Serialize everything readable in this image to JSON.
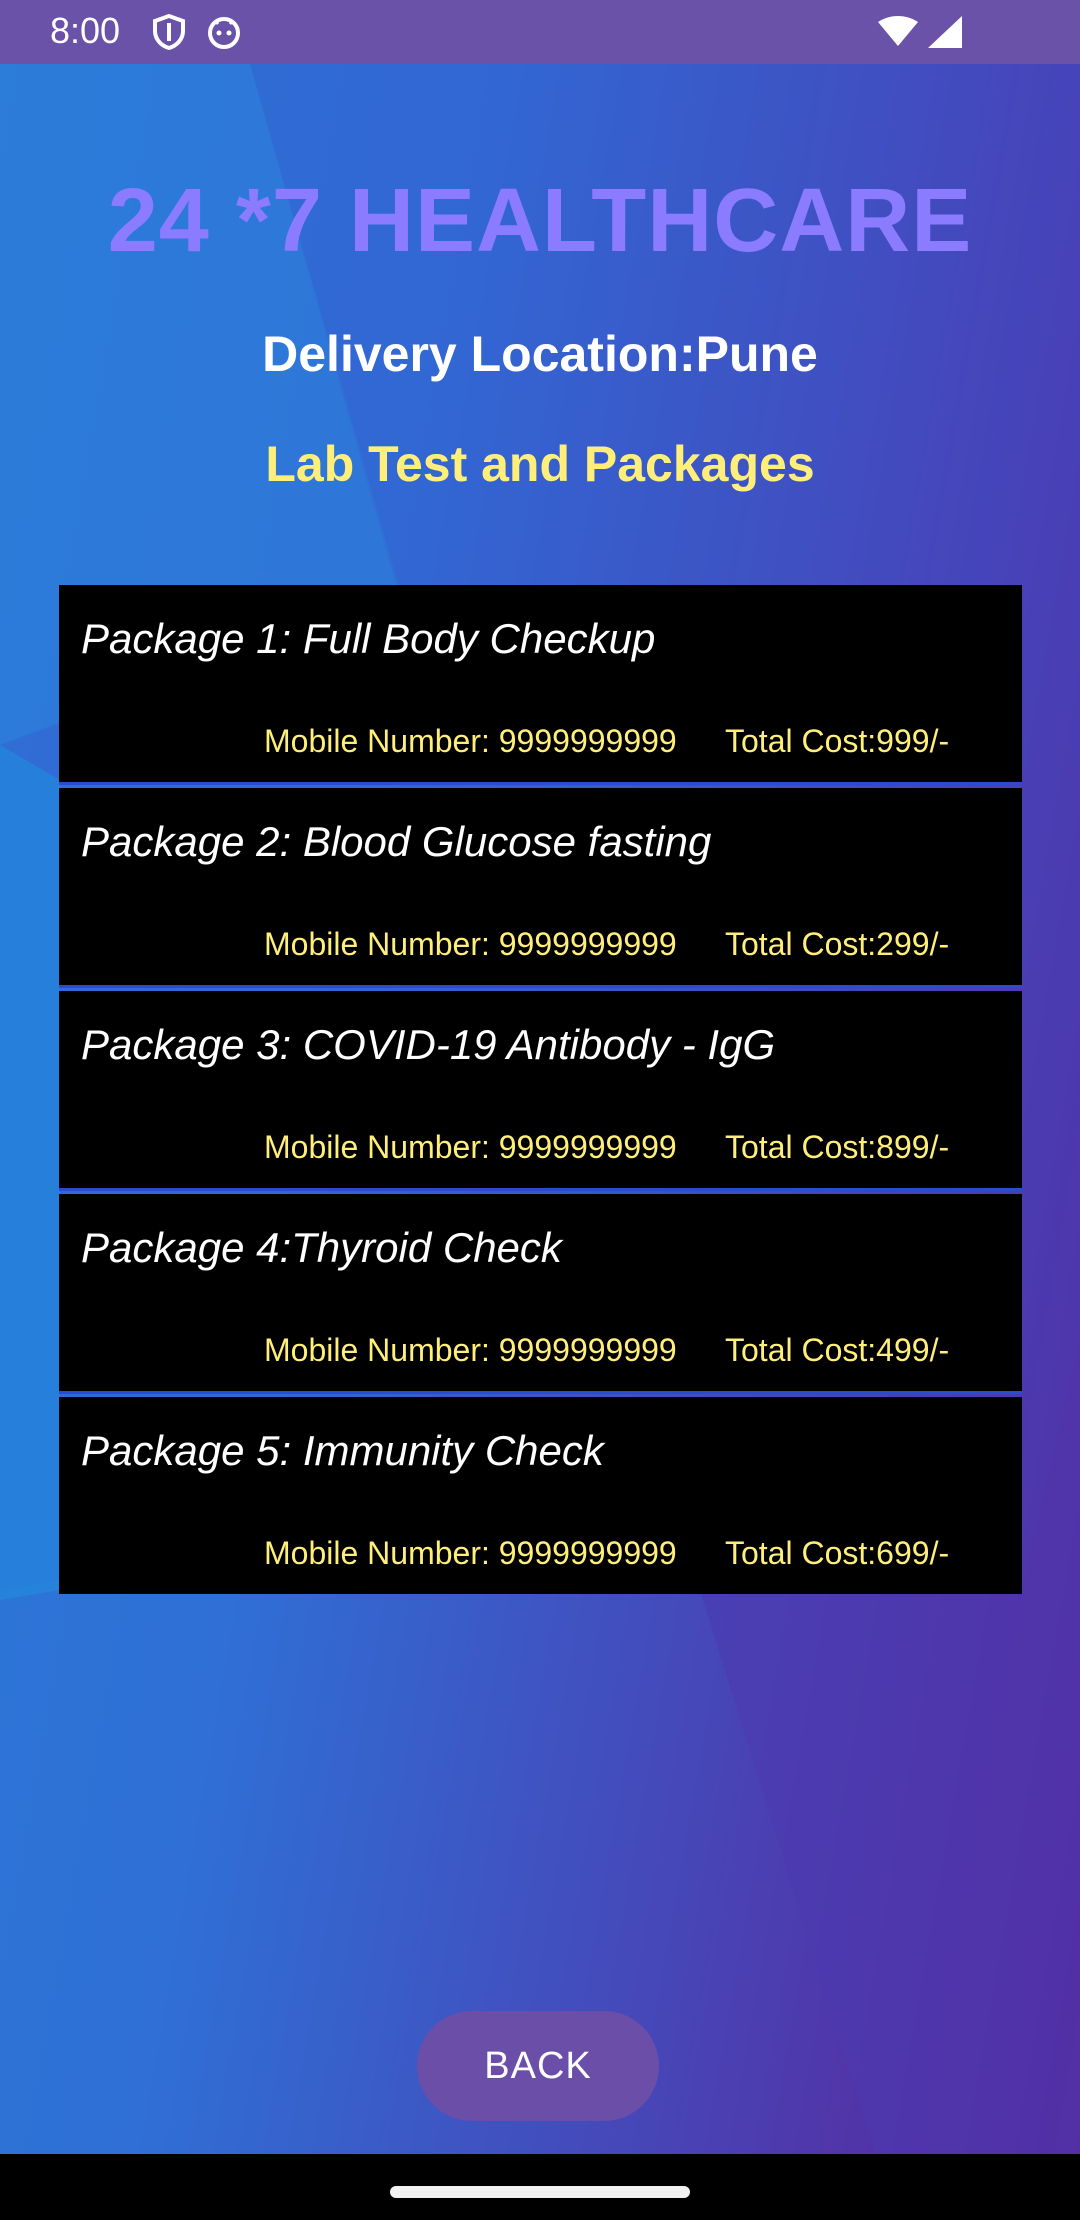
{
  "status_bar": {
    "time": "8:00",
    "icons": [
      "shield-icon",
      "robot-icon",
      "wifi-icon",
      "signal-icon"
    ]
  },
  "header": {
    "title": "24 *7 HEALTHCARE",
    "location": "Delivery Location:Pune",
    "subtitle": "Lab Test and Packages"
  },
  "packages": [
    {
      "name": "Package 1: Full Body Checkup",
      "mobile": "Mobile Number: 9999999999",
      "cost": "Total Cost:999/-"
    },
    {
      "name": "Package 2: Blood Glucose fasting",
      "mobile": "Mobile Number: 9999999999",
      "cost": "Total Cost:299/-"
    },
    {
      "name": "Package 3: COVID-19 Antibody - IgG",
      "mobile": "Mobile Number: 9999999999",
      "cost": "Total Cost:899/-"
    },
    {
      "name": "Package 4:Thyroid Check",
      "mobile": "Mobile Number: 9999999999",
      "cost": "Total Cost:499/-"
    },
    {
      "name": "Package 5: Immunity Check",
      "mobile": "Mobile Number: 9999999999",
      "cost": "Total Cost:699/-"
    }
  ],
  "back_label": "BACK",
  "colors": {
    "title": "#8b7bff",
    "subtitle": "#ffef7a",
    "card_background": "#000000",
    "button": "#6a4ea8"
  }
}
